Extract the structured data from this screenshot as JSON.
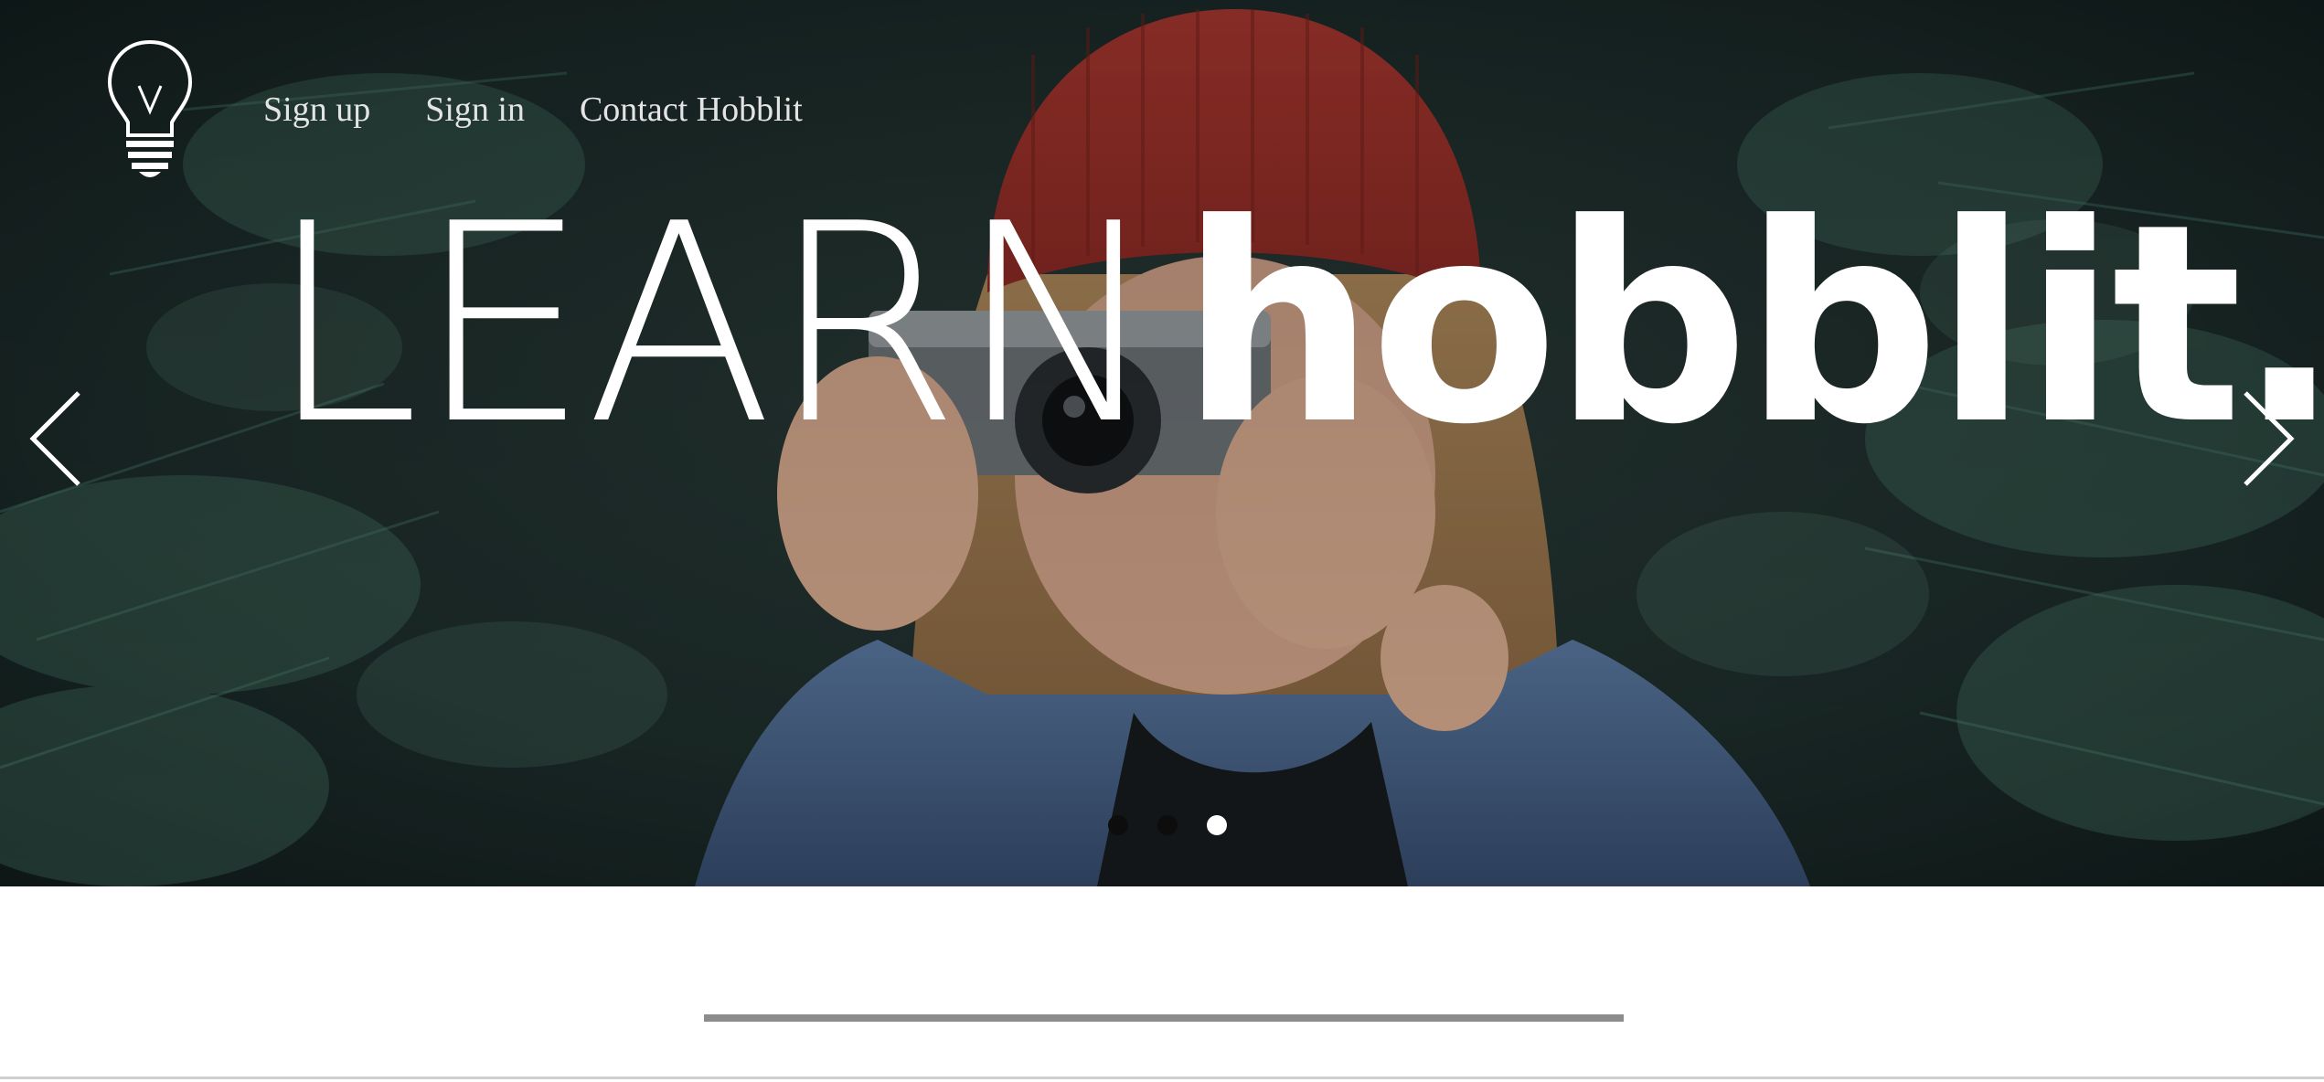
{
  "nav": {
    "items": [
      {
        "label": "Sign up"
      },
      {
        "label": "Sign in"
      },
      {
        "label": "Contact Hobblit"
      }
    ]
  },
  "hero": {
    "headline_light": "LEARN",
    "headline_bold": "hobblit.",
    "slide_count": 3,
    "active_slide": 3
  },
  "icons": {
    "logo": "lightbulb-icon",
    "prev": "chevron-left-icon",
    "next": "chevron-right-icon"
  },
  "colors": {
    "headline": "#ffffff",
    "nav_text": "#e4e4e4",
    "dot_inactive": "#0d0d0d",
    "dot_active": "#ffffff",
    "progress_bar": "#8c8c8c",
    "divider": "#cfcfcf"
  }
}
